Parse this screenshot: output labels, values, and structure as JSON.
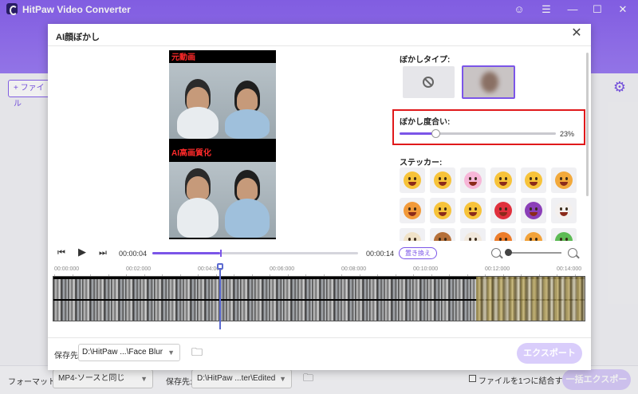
{
  "app": {
    "title": "HitPaw Video Converter",
    "add_file_label": "+ ファイル",
    "window_controls": [
      "☺",
      "☰",
      "—",
      "☐",
      "✕"
    ]
  },
  "footer": {
    "format_label": "フォーマット:",
    "format_value": "MP4-ソースと同じ",
    "save_label": "保存先:",
    "save_value": "D:\\HitPaw ...ter\\Edited",
    "merge_label": "ファイルを1つに結合する",
    "merge_checked": false,
    "convert_all_label": "一括エクスポート"
  },
  "modal": {
    "title": "AI顔ぼかし",
    "close_glyph": "✕",
    "preview": {
      "top_tag": "元動画",
      "bottom_tag": "AI高画質化"
    },
    "blur_type": {
      "label": "ぼかしタイプ:",
      "options": [
        "none",
        "face-blur"
      ],
      "selected": "face-blur"
    },
    "blur_degree": {
      "label": "ぼかし度合い:",
      "value": 23,
      "value_text": "23%"
    },
    "sticker": {
      "label": "ステッカー:",
      "items": [
        "grin",
        "laugh",
        "heart-eyes",
        "wink",
        "cool",
        "angry",
        "star",
        "mask",
        "party",
        "demon-red",
        "demon-purple",
        "clown",
        "cat",
        "monkey",
        "dog",
        "fox",
        "tiger",
        "frog"
      ]
    },
    "transport": {
      "current_time": "00:00:04",
      "total_time": "00:00:14",
      "progress": 0.33,
      "replace_label": "置き換え",
      "zoom_level": 0.1
    },
    "timeline": {
      "ruler": [
        "00:00:000",
        "00:02:000",
        "00:04:000",
        "00:06:000",
        "00:08:000",
        "00:10:000",
        "00:12:000",
        "00:14:000"
      ]
    },
    "save": {
      "label": "保存先:",
      "value": "D:\\HitPaw ...\\Face Blur",
      "export_label": "エクスポート"
    }
  },
  "colors": {
    "accent": "#7b55e8",
    "highlight_box": "#e0191b",
    "disabled_button": "#d9cdfb"
  }
}
